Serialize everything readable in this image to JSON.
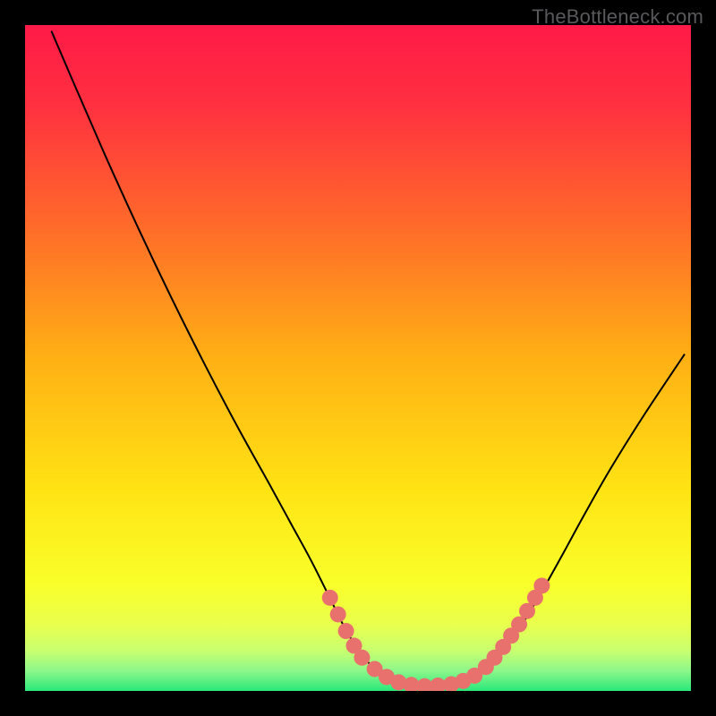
{
  "watermark": "TheBottleneck.com",
  "chart_data": {
    "type": "line",
    "title": "",
    "xlabel": "",
    "ylabel": "",
    "xlim": [
      0,
      100
    ],
    "ylim": [
      0,
      100
    ],
    "gradient_stops": [
      {
        "offset": 0.0,
        "color": "#ff1a47"
      },
      {
        "offset": 0.12,
        "color": "#ff3040"
      },
      {
        "offset": 0.3,
        "color": "#ff6a2a"
      },
      {
        "offset": 0.5,
        "color": "#ffb014"
      },
      {
        "offset": 0.7,
        "color": "#ffe414"
      },
      {
        "offset": 0.84,
        "color": "#f9ff2a"
      },
      {
        "offset": 0.9,
        "color": "#e9ff4d"
      },
      {
        "offset": 0.94,
        "color": "#c8ff70"
      },
      {
        "offset": 0.97,
        "color": "#8cf78a"
      },
      {
        "offset": 1.0,
        "color": "#2ae87a"
      }
    ],
    "series": [
      {
        "name": "curve",
        "stroke": "#000000",
        "stroke_width": 2,
        "points": [
          {
            "x": 4.0,
            "y": 99.0
          },
          {
            "x": 7.0,
            "y": 92.0
          },
          {
            "x": 12.0,
            "y": 80.5
          },
          {
            "x": 17.0,
            "y": 69.5
          },
          {
            "x": 22.0,
            "y": 59.0
          },
          {
            "x": 27.0,
            "y": 49.0
          },
          {
            "x": 32.0,
            "y": 39.5
          },
          {
            "x": 37.0,
            "y": 30.5
          },
          {
            "x": 40.0,
            "y": 25.0
          },
          {
            "x": 43.0,
            "y": 19.5
          },
          {
            "x": 46.0,
            "y": 13.5
          },
          {
            "x": 48.0,
            "y": 9.5
          },
          {
            "x": 50.0,
            "y": 6.2
          },
          {
            "x": 52.0,
            "y": 3.8
          },
          {
            "x": 54.0,
            "y": 2.2
          },
          {
            "x": 56.0,
            "y": 1.2
          },
          {
            "x": 58.0,
            "y": 0.8
          },
          {
            "x": 60.0,
            "y": 0.7
          },
          {
            "x": 62.0,
            "y": 0.8
          },
          {
            "x": 64.0,
            "y": 1.0
          },
          {
            "x": 66.0,
            "y": 1.6
          },
          {
            "x": 68.0,
            "y": 2.6
          },
          {
            "x": 70.0,
            "y": 4.2
          },
          {
            "x": 72.0,
            "y": 6.2
          },
          {
            "x": 74.0,
            "y": 9.0
          },
          {
            "x": 76.0,
            "y": 12.2
          },
          {
            "x": 78.0,
            "y": 15.6
          },
          {
            "x": 81.0,
            "y": 21.0
          },
          {
            "x": 84.0,
            "y": 26.5
          },
          {
            "x": 88.0,
            "y": 33.5
          },
          {
            "x": 93.0,
            "y": 41.5
          },
          {
            "x": 99.0,
            "y": 50.5
          }
        ]
      }
    ],
    "markers": {
      "name": "dots",
      "fill": "#e8716e",
      "r": 9,
      "points": [
        {
          "x": 45.8,
          "y": 14.0
        },
        {
          "x": 47.0,
          "y": 11.5
        },
        {
          "x": 48.2,
          "y": 9.0
        },
        {
          "x": 49.4,
          "y": 6.8
        },
        {
          "x": 50.6,
          "y": 5.0
        },
        {
          "x": 52.5,
          "y": 3.3
        },
        {
          "x": 54.3,
          "y": 2.1
        },
        {
          "x": 56.1,
          "y": 1.3
        },
        {
          "x": 58.0,
          "y": 0.9
        },
        {
          "x": 60.0,
          "y": 0.7
        },
        {
          "x": 62.0,
          "y": 0.8
        },
        {
          "x": 64.0,
          "y": 1.0
        },
        {
          "x": 65.8,
          "y": 1.5
        },
        {
          "x": 67.5,
          "y": 2.3
        },
        {
          "x": 69.2,
          "y": 3.6
        },
        {
          "x": 70.5,
          "y": 5.0
        },
        {
          "x": 71.8,
          "y": 6.6
        },
        {
          "x": 73.0,
          "y": 8.3
        },
        {
          "x": 74.2,
          "y": 10.0
        },
        {
          "x": 75.4,
          "y": 12.0
        },
        {
          "x": 76.6,
          "y": 14.0
        },
        {
          "x": 77.6,
          "y": 15.8
        }
      ]
    }
  }
}
